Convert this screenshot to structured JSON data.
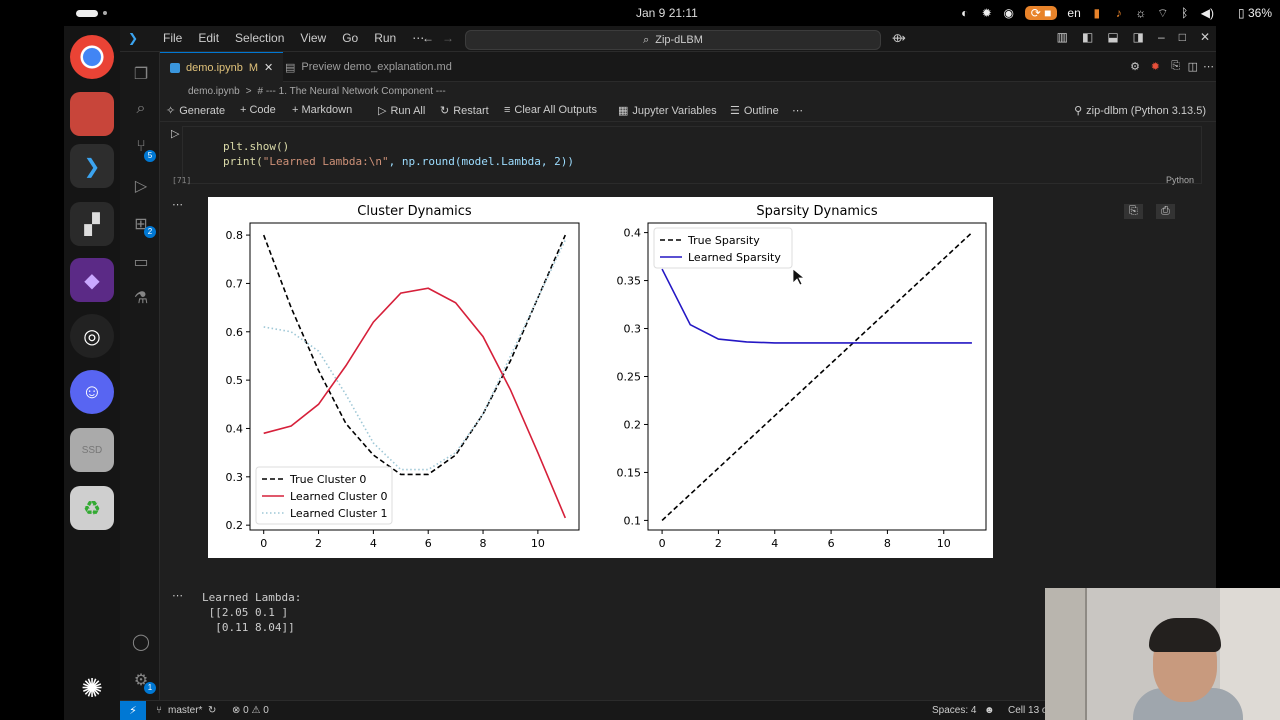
{
  "system": {
    "clock": "Jan 9  21:11",
    "lang": "en",
    "battery": "36%"
  },
  "vscode": {
    "menu": [
      "File",
      "Edit",
      "Selection",
      "View",
      "Go",
      "Run",
      "⋯"
    ],
    "command_center": "Zip-dLBM",
    "tabs": [
      {
        "label": "demo.ipynb",
        "modified": "M"
      },
      {
        "label": "Preview demo_explanation.md"
      }
    ],
    "breadcrumb": [
      "demo.ipynb",
      ">",
      "# --- 1. The Neural Network Component ---"
    ],
    "toolbar": {
      "generate": "Generate",
      "code": "+ Code",
      "markdown": "+ Markdown",
      "run_all": "Run All",
      "restart": "Restart",
      "clear": "Clear All Outputs",
      "variables": "Jupyter Variables",
      "outline": "Outline",
      "more": "⋯",
      "kernel": "zip-dlbm (Python 3.13.5)"
    },
    "cell": {
      "line1": "plt.show()",
      "line2_fn": "print(",
      "line2_str": "\"Learned Lambda:\\n\"",
      "line2_rest": ", np.round(model.Lambda, 2))",
      "exec": "[71]",
      "lang": "Python"
    },
    "output_text": "Learned Lambda:\n [[2.05 0.1 ]\n  [0.11 8.04]]",
    "status": {
      "branch": "master*",
      "problems": "⊗ 0 ⚠ 0",
      "spaces": "Spaces: 4",
      "cell": "Cell 13 o"
    }
  },
  "chart_data": [
    {
      "type": "line",
      "title": "Cluster Dynamics",
      "xlim": [
        -0.5,
        11.5
      ],
      "ylim": [
        0.19,
        0.825
      ],
      "xticks": [
        0,
        2,
        4,
        6,
        8,
        10
      ],
      "yticks": [
        0.2,
        0.3,
        0.4,
        0.5,
        0.6,
        0.7,
        0.8
      ],
      "legend": "bottom-left",
      "series": [
        {
          "name": "True Cluster 0",
          "style": "dashed",
          "color": "#000000",
          "x": [
            0,
            1,
            2,
            3,
            4,
            5,
            6,
            7,
            8,
            9,
            10,
            11
          ],
          "y": [
            0.8,
            0.65,
            0.52,
            0.41,
            0.345,
            0.305,
            0.305,
            0.345,
            0.43,
            0.54,
            0.67,
            0.8
          ]
        },
        {
          "name": "Learned Cluster 0",
          "style": "solid",
          "color": "#d6203a",
          "x": [
            0,
            1,
            2,
            3,
            4,
            5,
            6,
            7,
            8,
            9,
            10,
            11
          ],
          "y": [
            0.39,
            0.405,
            0.45,
            0.53,
            0.62,
            0.68,
            0.69,
            0.66,
            0.59,
            0.48,
            0.35,
            0.215
          ]
        },
        {
          "name": "Learned Cluster 1",
          "style": "dotted",
          "color": "#9ec7d6",
          "x": [
            0,
            1,
            2,
            3,
            4,
            5,
            6,
            7,
            8,
            9,
            10,
            11
          ],
          "y": [
            0.61,
            0.6,
            0.56,
            0.47,
            0.37,
            0.315,
            0.315,
            0.35,
            0.43,
            0.55,
            0.67,
            0.79
          ]
        }
      ]
    },
    {
      "type": "line",
      "title": "Sparsity Dynamics",
      "xlim": [
        -0.5,
        11.5
      ],
      "ylim": [
        0.09,
        0.41
      ],
      "xticks": [
        0,
        2,
        4,
        6,
        8,
        10
      ],
      "yticks": [
        0.1,
        0.15,
        0.2,
        0.25,
        0.3,
        0.35,
        0.4
      ],
      "legend": "top-left",
      "series": [
        {
          "name": "True Sparsity",
          "style": "dashed",
          "color": "#000000",
          "x": [
            0,
            11
          ],
          "y": [
            0.1,
            0.4
          ]
        },
        {
          "name": "Learned Sparsity",
          "style": "solid",
          "color": "#2417c4",
          "x": [
            0,
            1,
            2,
            3,
            4,
            5,
            6,
            7,
            8,
            9,
            10,
            11
          ],
          "y": [
            0.362,
            0.304,
            0.289,
            0.286,
            0.285,
            0.285,
            0.285,
            0.285,
            0.285,
            0.285,
            0.285,
            0.285
          ]
        }
      ]
    }
  ]
}
